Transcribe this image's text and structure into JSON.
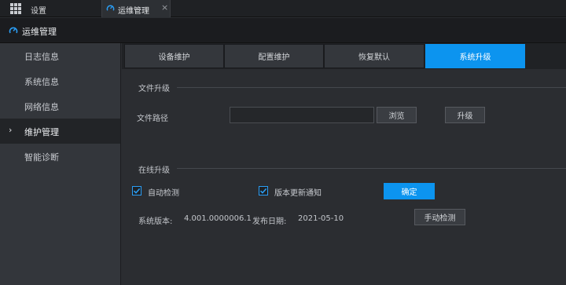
{
  "top_tabs": {
    "settings_label": "设置",
    "ops_label": "运维管理",
    "close_glyph": "×"
  },
  "title": "运维管理",
  "sidebar": {
    "items": [
      {
        "label": "日志信息"
      },
      {
        "label": "系统信息"
      },
      {
        "label": "网络信息"
      },
      {
        "label": "维护管理"
      },
      {
        "label": "智能诊断"
      }
    ],
    "active_index": 3,
    "chevron": "›"
  },
  "tabs": [
    {
      "label": "设备维护"
    },
    {
      "label": "配置维护"
    },
    {
      "label": "恢复默认"
    },
    {
      "label": "系统升级"
    }
  ],
  "active_tab": 3,
  "file_upgrade": {
    "section_title": "文件升级",
    "path_label": "文件路径",
    "path_value": "",
    "browse_label": "浏览",
    "upgrade_label": "升级"
  },
  "online_upgrade": {
    "section_title": "在线升级",
    "auto_check_label": "自动检测",
    "auto_check_checked": true,
    "notify_label": "版本更新通知",
    "notify_checked": true,
    "confirm_label": "确定",
    "version_label": "系统版本:",
    "version_value": "4.001.0000006.1",
    "date_label": "发布日期:",
    "date_value": "2021-05-10",
    "manual_check_label": "手动检测"
  },
  "colors": {
    "accent": "#0c94ef",
    "background": "#2b2d31",
    "sidebar": "#33363b"
  },
  "icons": {
    "settings_tab": "grid-icon",
    "ops_tab": "gauge-icon",
    "title": "gauge-icon",
    "checkbox": "checkmark-icon"
  }
}
